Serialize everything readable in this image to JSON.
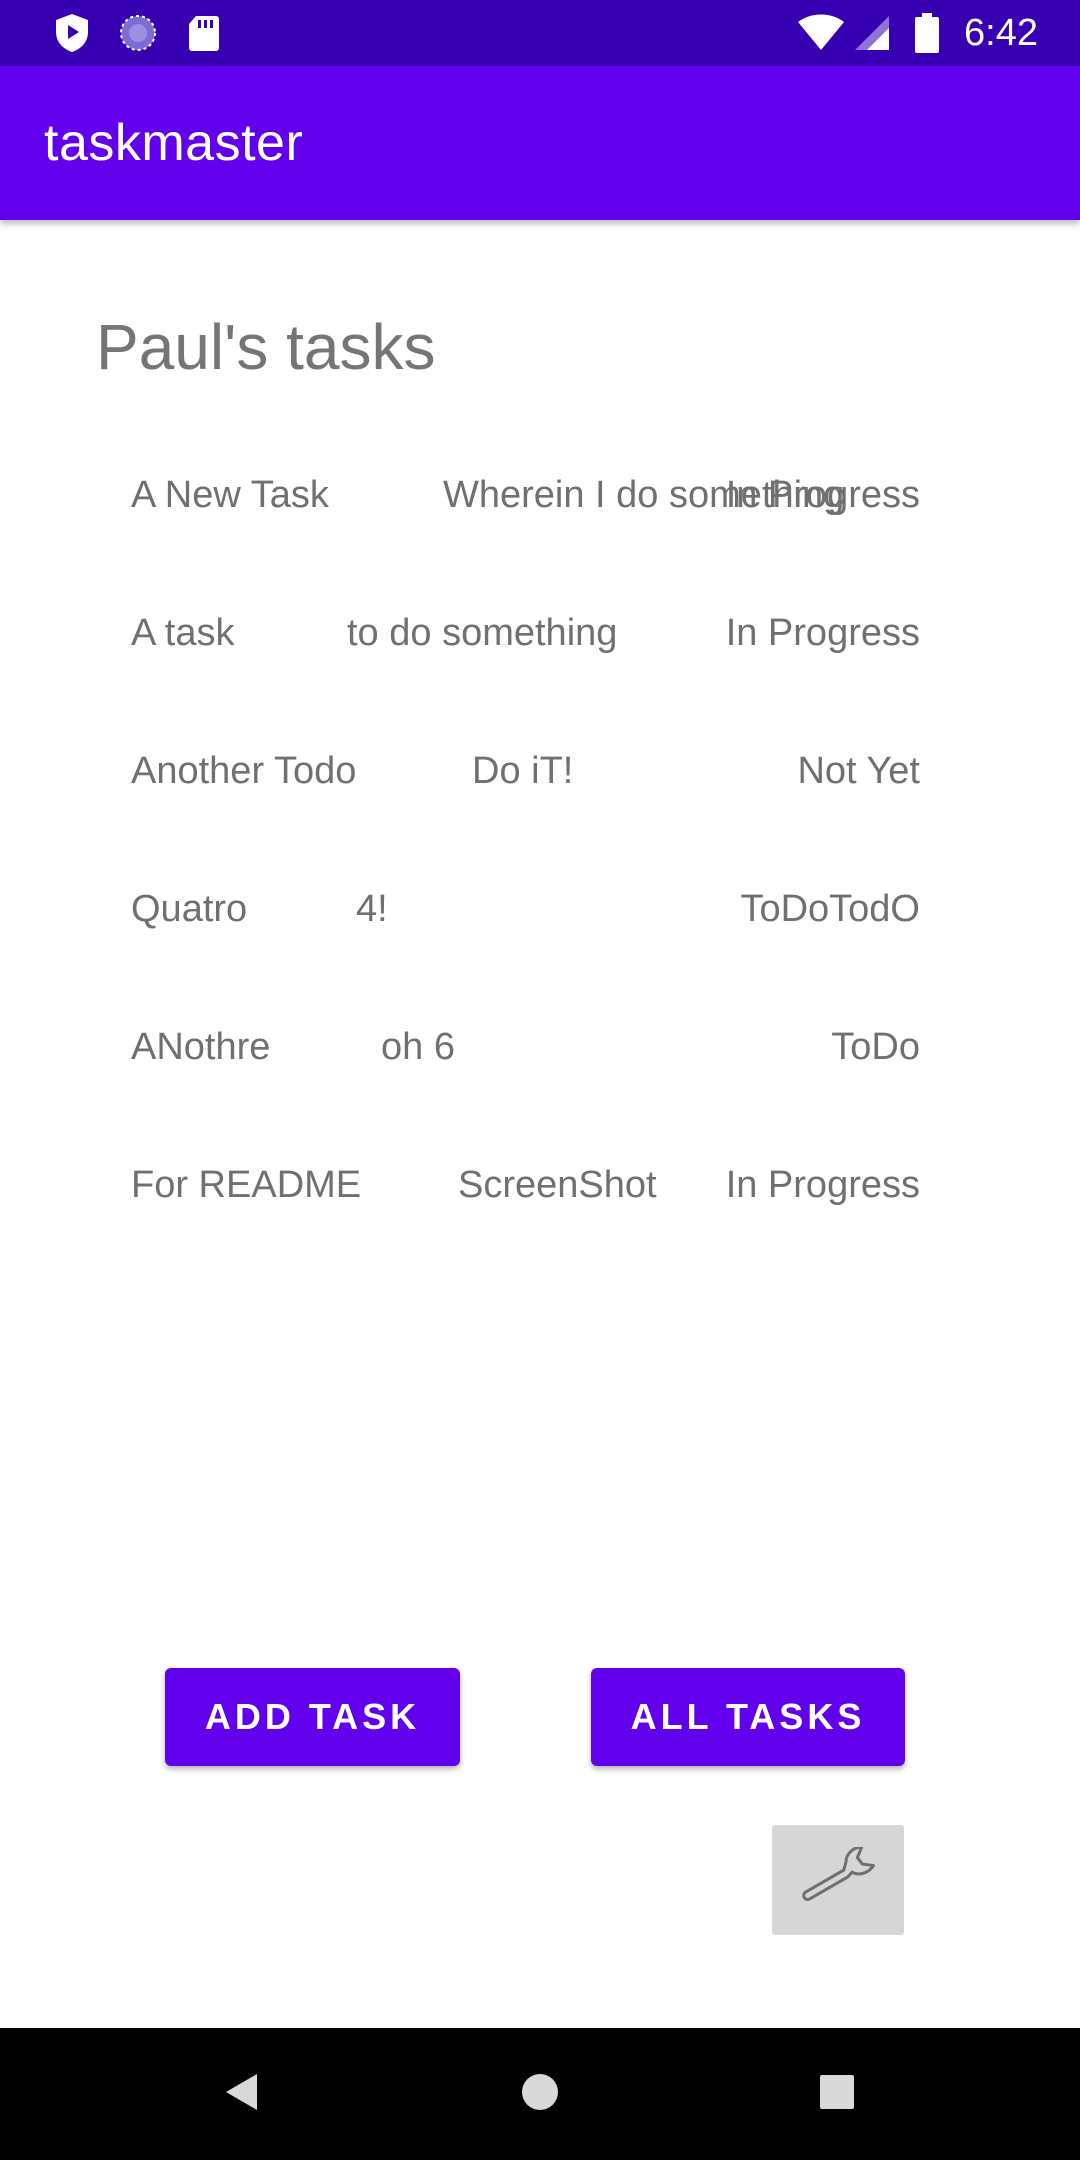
{
  "status_bar": {
    "time": "6:42",
    "icons": [
      "play-protect-icon",
      "sync-circle-icon",
      "sd-card-icon",
      "wifi-icon",
      "signal-icon",
      "battery-icon"
    ]
  },
  "app_bar": {
    "title": "taskmaster",
    "color": "#6200ee",
    "status_color": "#3700b3"
  },
  "main": {
    "heading": "Paul's tasks",
    "tasks": [
      {
        "title": "A New Task",
        "body": "Wherein I do something",
        "state": "In Progress"
      },
      {
        "title": "A task",
        "body": "to do something",
        "state": "In Progress"
      },
      {
        "title": "Another Todo",
        "body": "Do iT!",
        "state": "Not Yet"
      },
      {
        "title": "Quatro",
        "body": "4!",
        "state": "ToDoTodO"
      },
      {
        "title": "ANothre",
        "body": "oh 6",
        "state": "ToDo"
      },
      {
        "title": "For README",
        "body": "ScreenShot",
        "state": "In Progress"
      }
    ]
  },
  "buttons": {
    "add_task": "ADD TASK",
    "all_tasks": "ALL TASKS",
    "settings_icon": "wrench-icon"
  },
  "nav_bar": {
    "icons": [
      "back-icon",
      "home-icon",
      "recents-icon"
    ]
  }
}
